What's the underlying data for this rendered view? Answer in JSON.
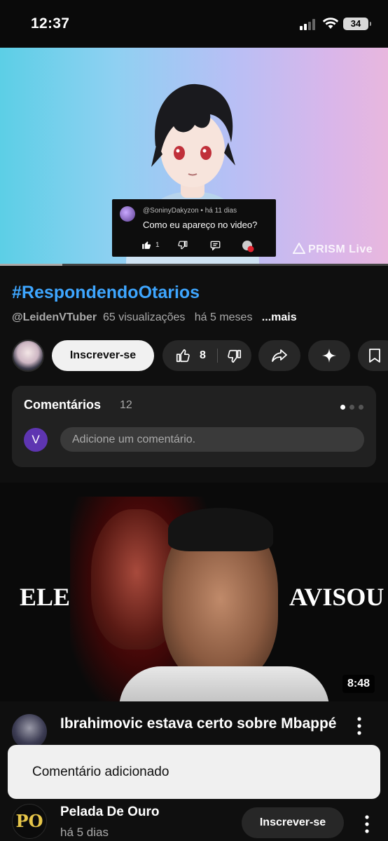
{
  "status_bar": {
    "time": "12:37",
    "battery": "34",
    "icons": [
      "signal-icon",
      "wifi-icon",
      "battery-icon"
    ]
  },
  "video": {
    "overlay_comment": {
      "user": "@SoninyDakyzon • há 11 dias",
      "text": "Como eu apareço no video?",
      "likes": "1"
    },
    "watermark": "PRISM Live",
    "progress_fraction": 0.16
  },
  "info": {
    "title": "#RespondendoOtarios",
    "channel": "@LeidenVTuber",
    "views": "65 visualizações",
    "age": "há 5 meses",
    "more": "...mais"
  },
  "actions": {
    "subscribe": "Inscrever-se",
    "likes": "8"
  },
  "comments": {
    "title": "Comentários",
    "count": "12",
    "user_initial": "V",
    "placeholder": "Adicione um comentário."
  },
  "next_video": {
    "thumbnail_left_text": "ELE",
    "thumbnail_right_text": "AVISOU",
    "duration": "8:48",
    "title": "Ibrahimovic estava certo sobre Mbappé"
  },
  "toast": {
    "message": "Comentário adicionado"
  },
  "bottom_channel": {
    "avatar_text": "PO",
    "name": "Pelada De Ouro",
    "age": "há 5 dias",
    "subscribe": "Inscrever-se"
  },
  "colors": {
    "accent_link": "#3ea6ff",
    "background": "#0f0f0f",
    "card": "#212121",
    "pill": "#272727"
  }
}
